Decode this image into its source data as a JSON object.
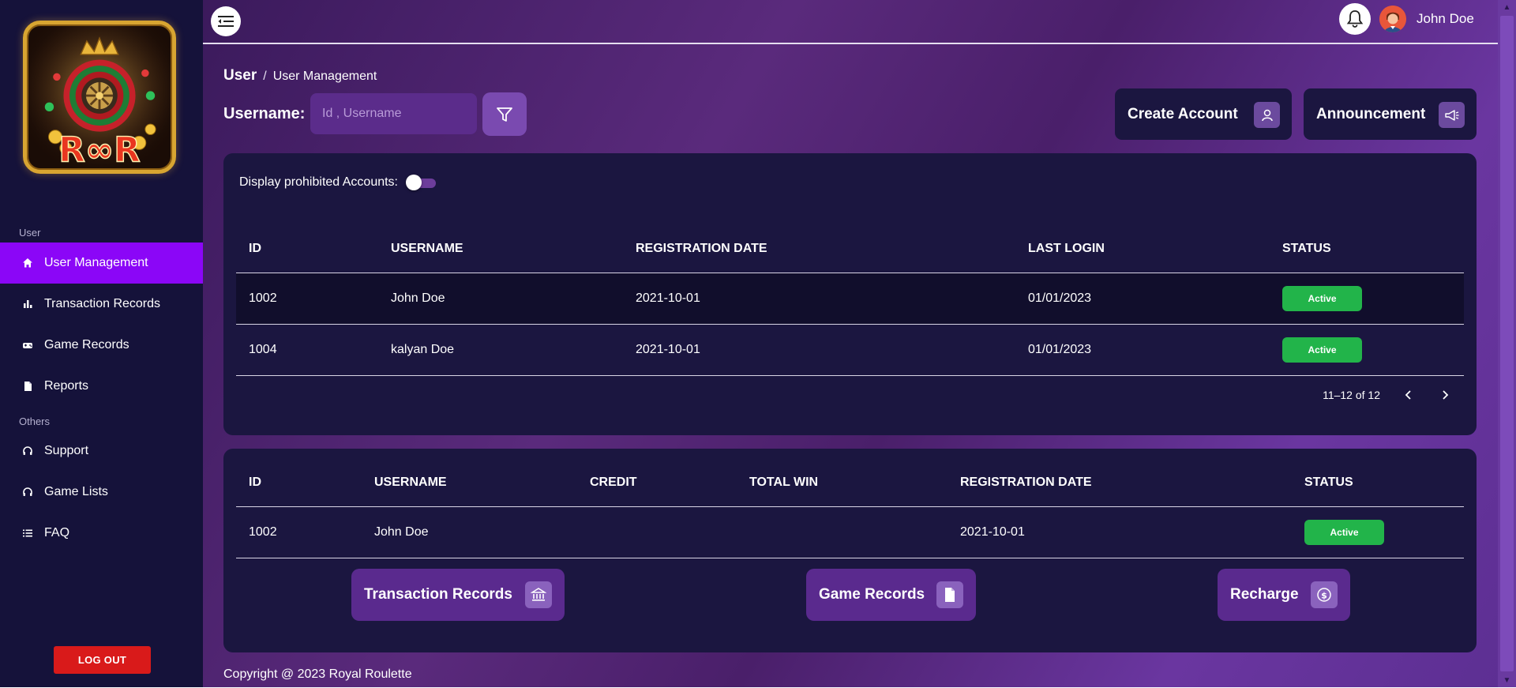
{
  "topbar": {
    "user_name": "John Doe",
    "menu_icon": "menu-collapse-icon",
    "bell_icon": "bell-icon"
  },
  "sidebar": {
    "logo_alt": "Royal Roulette",
    "sections": [
      {
        "title": "User"
      },
      {
        "title": "Others"
      }
    ],
    "items": [
      {
        "label": "User Management",
        "icon": "home-icon",
        "active": true
      },
      {
        "label": "Transaction Records",
        "icon": "bar-chart-icon"
      },
      {
        "label": "Game Records",
        "icon": "gamepad-icon"
      },
      {
        "label": "Reports",
        "icon": "document-icon"
      },
      {
        "label": "Support",
        "icon": "headset-icon"
      },
      {
        "label": "Game Lists",
        "icon": "headset-icon"
      },
      {
        "label": "FAQ",
        "icon": "list-icon"
      }
    ],
    "logout_label": "LOG OUT"
  },
  "breadcrumb": {
    "root": "User",
    "separator": "/",
    "current": "User Management"
  },
  "search": {
    "label": "Username:",
    "placeholder": "Id , Username",
    "value": ""
  },
  "header_buttons": {
    "create_account": "Create Account",
    "announcement": "Announcement"
  },
  "users_card": {
    "toggle_label": "Display prohibited Accounts:",
    "toggle_on": false,
    "columns": [
      "ID",
      "USERNAME",
      "REGISTRATION DATE",
      "LAST LOGIN",
      "STATUS"
    ],
    "rows": [
      {
        "id": "1002",
        "username": "John Doe",
        "registration_date": "2021-10-01",
        "last_login": "01/01/2023",
        "status": "Active"
      },
      {
        "id": "1004",
        "username": "kalyan Doe",
        "registration_date": "2021-10-01",
        "last_login": "01/01/2023",
        "status": "Active"
      }
    ],
    "pagination": "11–12 of 12"
  },
  "detail_card": {
    "columns": [
      "ID",
      "USERNAME",
      "CREDIT",
      "TOTAL WIN",
      "REGISTRATION DATE",
      "STATUS"
    ],
    "rows": [
      {
        "id": "1002",
        "username": "John Doe",
        "credit": "",
        "total_win": "",
        "registration_date": "2021-10-01",
        "status": "Active"
      }
    ],
    "buttons": {
      "transaction_records": "Transaction Records",
      "game_records": "Game Records",
      "recharge": "Recharge"
    }
  },
  "footer": {
    "copyright": "Copyright @ 2023 Royal Roulette"
  },
  "colors": {
    "sidebar_bg": "#15123a",
    "active_nav": "#8b06f7",
    "card_bg": "#1b1640",
    "status_active": "#22b44a",
    "logout": "#d91a1a"
  }
}
